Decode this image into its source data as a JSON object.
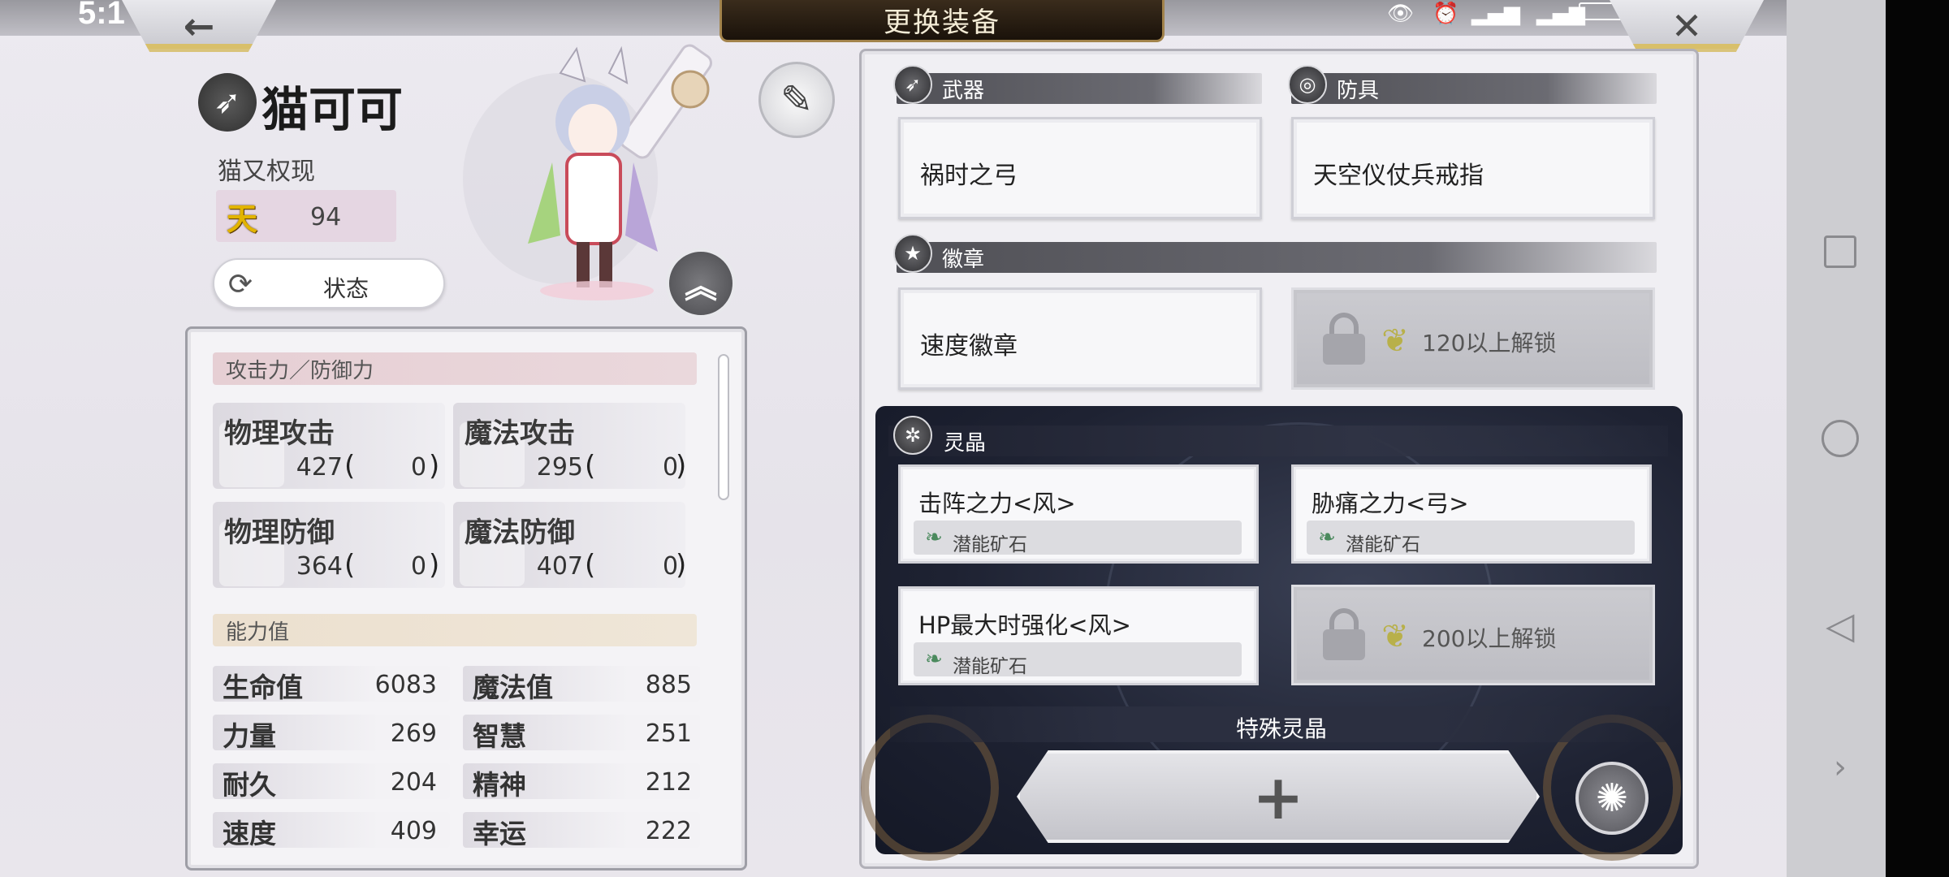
{
  "status_bar": {
    "time": "5:1"
  },
  "header": {
    "title": "更换装备",
    "back_icon": "arrow-left-icon",
    "close_icon": "close-icon"
  },
  "character": {
    "name": "猫可可",
    "title": "猫又权现",
    "rank_icon_text": "天",
    "rank_value": "94",
    "status_button_label": "状态"
  },
  "stats": {
    "attack_defense_header": "攻击力／防御力",
    "cards": [
      {
        "label": "物理攻击",
        "value": "427",
        "bonus": "0"
      },
      {
        "label": "魔法攻击",
        "value": "295",
        "bonus": "0"
      },
      {
        "label": "物理防御",
        "value": "364",
        "bonus": "0"
      },
      {
        "label": "魔法防御",
        "value": "407",
        "bonus": "0"
      }
    ],
    "ability_header": "能力值",
    "abilities": [
      {
        "label": "生命值",
        "value": "6083"
      },
      {
        "label": "魔法值",
        "value": "885"
      },
      {
        "label": "力量",
        "value": "269"
      },
      {
        "label": "智慧",
        "value": "251"
      },
      {
        "label": "耐久",
        "value": "204"
      },
      {
        "label": "精神",
        "value": "212"
      },
      {
        "label": "速度",
        "value": "409"
      },
      {
        "label": "幸运",
        "value": "222"
      }
    ]
  },
  "equipment": {
    "weapon_header": "武器",
    "armor_header": "防具",
    "weapon": "祸时之弓",
    "armor": "天空仪仗兵戒指",
    "badge_header": "徽章",
    "badge": "速度徽章",
    "badge_locked": "120以上解锁",
    "crystal_header": "灵晶",
    "crystals": [
      {
        "name": "击阵之力<风>",
        "sub": "潜能矿石"
      },
      {
        "name": "胁痛之力<弓>",
        "sub": "潜能矿石"
      },
      {
        "name": "HP最大时强化<风>",
        "sub": "潜能矿石"
      }
    ],
    "crystal_locked": "200以上解锁",
    "special_crystal_label": "特殊灵晶",
    "add_label": "+"
  }
}
